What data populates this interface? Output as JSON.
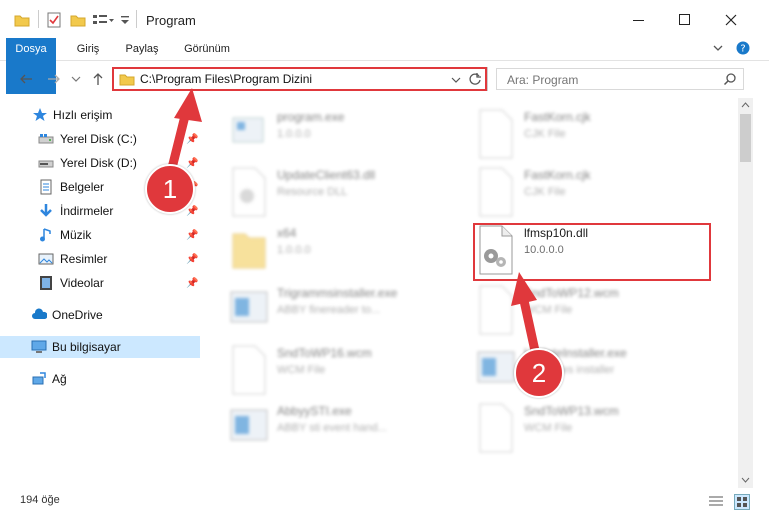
{
  "window": {
    "title": "Program"
  },
  "ribbon": {
    "tabs": [
      "Dosya",
      "Giriş",
      "Paylaş",
      "Görünüm"
    ]
  },
  "address": {
    "path": "C:\\Program Files\\Program Dizini"
  },
  "search": {
    "placeholder": "Ara: Program"
  },
  "sidebar": {
    "quick_access": "Hızlı erişim",
    "items": [
      {
        "label": "Yerel Disk (C:)",
        "icon": "drive-icon"
      },
      {
        "label": "Yerel Disk (D:)",
        "icon": "drive-icon"
      },
      {
        "label": "Belgeler",
        "icon": "documents-icon"
      },
      {
        "label": "İndirmeler",
        "icon": "download-icon"
      },
      {
        "label": "Müzik",
        "icon": "music-icon"
      },
      {
        "label": "Resimler",
        "icon": "pictures-icon"
      },
      {
        "label": "Videolar",
        "icon": "videos-icon"
      }
    ],
    "onedrive": "OneDrive",
    "this_pc": "Bu bilgisayar",
    "network": "Ağ"
  },
  "files": [
    {
      "name": "program.exe",
      "desc": "1.0.0.0"
    },
    {
      "name": "FastKorn.cjk",
      "desc": "CJK File"
    },
    {
      "name": "UpdateClient63.dll",
      "desc": "Resource DLL"
    },
    {
      "name": "FastKorn.cjk",
      "desc": "CJK File"
    },
    {
      "name": "x64",
      "desc": "1.0.0.0"
    },
    {
      "name": "lfmsp10n.dll",
      "desc": "10.0.0.0"
    },
    {
      "name": "Trigrammsinstaller.exe",
      "desc": "ABBY finereader to..."
    },
    {
      "name": "SndToWP12.wcm",
      "desc": "WCM File"
    },
    {
      "name": "SndToWP16.wcm",
      "desc": "WCM File"
    },
    {
      "name": "UpdateInstaller.exe",
      "desc": "Y updates installer"
    },
    {
      "name": "AbbyySTI.exe",
      "desc": "ABBY sti event hand..."
    },
    {
      "name": "SndToWP13.wcm",
      "desc": "WCM File"
    }
  ],
  "status": {
    "count": "194 öğe"
  },
  "badges": {
    "one": "1",
    "two": "2"
  },
  "colors": {
    "accent": "#1979ca",
    "highlight": "#e0383c",
    "selected": "#cce8ff"
  }
}
